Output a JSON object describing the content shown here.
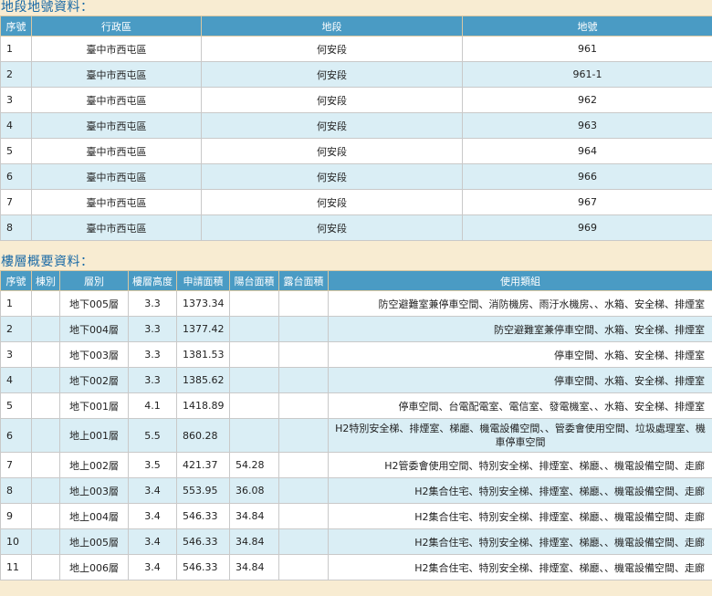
{
  "lot_section": {
    "title": "地段地號資料：",
    "headers": [
      "序號",
      "行政區",
      "地段",
      "地號"
    ],
    "rows": [
      [
        "1",
        "臺中市西屯區",
        "何安段",
        "961"
      ],
      [
        "2",
        "臺中市西屯區",
        "何安段",
        "961-1"
      ],
      [
        "3",
        "臺中市西屯區",
        "何安段",
        "962"
      ],
      [
        "4",
        "臺中市西屯區",
        "何安段",
        "963"
      ],
      [
        "5",
        "臺中市西屯區",
        "何安段",
        "964"
      ],
      [
        "6",
        "臺中市西屯區",
        "何安段",
        "966"
      ],
      [
        "7",
        "臺中市西屯區",
        "何安段",
        "967"
      ],
      [
        "8",
        "臺中市西屯區",
        "何安段",
        "969"
      ]
    ]
  },
  "floor_section": {
    "title": "樓層概要資料：",
    "headers": [
      "序號",
      "棟別",
      "層別",
      "樓層高度",
      "申請面積",
      "陽台面積",
      "露台面積",
      "使用類組"
    ],
    "rows": [
      [
        "1",
        "",
        "地下005層",
        "3.3",
        "1373.34",
        "",
        "",
        "防空避難室兼停車空間、消防機房、雨汙水機房、、水箱、安全梯、排煙室"
      ],
      [
        "2",
        "",
        "地下004層",
        "3.3",
        "1377.42",
        "",
        "",
        "防空避難室兼停車空間、水箱、安全梯、排煙室"
      ],
      [
        "3",
        "",
        "地下003層",
        "3.3",
        "1381.53",
        "",
        "",
        "停車空間、水箱、安全梯、排煙室"
      ],
      [
        "4",
        "",
        "地下002層",
        "3.3",
        "1385.62",
        "",
        "",
        "停車空間、水箱、安全梯、排煙室"
      ],
      [
        "5",
        "",
        "地下001層",
        "4.1",
        "1418.89",
        "",
        "",
        "停車空間、台電配電室、電信室、發電機室、、水箱、安全梯、排煙室"
      ],
      [
        "6",
        "",
        "地上001層",
        "5.5",
        "860.28",
        "",
        "",
        "H2特別安全梯、排煙室、梯廳、機電設備空間、、管委會使用空間、垃圾處理室、機車停車空間"
      ],
      [
        "7",
        "",
        "地上002層",
        "3.5",
        "421.37",
        "54.28",
        "",
        "H2管委會使用空間、特別安全梯、排煙室、梯廳、、機電設備空間、走廊"
      ],
      [
        "8",
        "",
        "地上003層",
        "3.4",
        "553.95",
        "36.08",
        "",
        "H2集合住宅、特別安全梯、排煙室、梯廳、、機電設備空間、走廊"
      ],
      [
        "9",
        "",
        "地上004層",
        "3.4",
        "546.33",
        "34.84",
        "",
        "H2集合住宅、特別安全梯、排煙室、梯廳、、機電設備空間、走廊"
      ],
      [
        "10",
        "",
        "地上005層",
        "3.4",
        "546.33",
        "34.84",
        "",
        "H2集合住宅、特別安全梯、排煙室、梯廳、、機電設備空間、走廊"
      ],
      [
        "11",
        "",
        "地上006層",
        "3.4",
        "546.33",
        "34.84",
        "",
        "H2集合住宅、特別安全梯、排煙室、梯廳、、機電設備空間、走廊"
      ]
    ]
  }
}
